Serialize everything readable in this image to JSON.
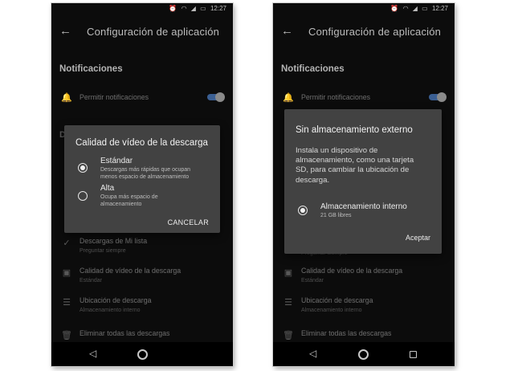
{
  "status_bar": {
    "time": "12:27"
  },
  "left": {
    "app_title": "Configuración de aplicación",
    "notifications_header": "Notificaciones",
    "permit_notifications": "Permitir notificaciones",
    "peek_section_letter": "D",
    "rows": [
      {
        "title": "Descargas de Mi lista",
        "subtitle": "Preguntar siempre",
        "icon": "check-icon"
      },
      {
        "title": "Calidad de vídeo de la descarga",
        "subtitle": "Estándar",
        "icon": "video-quality-icon"
      },
      {
        "title": "Ubicación de descarga",
        "subtitle": "Almacenamiento interno",
        "icon": "storage-icon"
      },
      {
        "title": "Eliminar todas las descargas",
        "subtitle": "",
        "icon": "trash-icon"
      }
    ],
    "dialog": {
      "title": "Calidad de vídeo de la descarga",
      "options": [
        {
          "label": "Estándar",
          "desc_line1": "Descargas más rápidas que ocupan",
          "desc_line2": "menos espacio de almacenamiento",
          "selected": true
        },
        {
          "label": "Alta",
          "desc_line1": "Ocupa más espacio de",
          "desc_line2": "almacenamiento",
          "selected": false
        }
      ],
      "cancel": "CANCELAR"
    }
  },
  "right": {
    "app_title": "Configuración de aplicación",
    "notifications_header": "Notificaciones",
    "permit_notifications": "Permitir notificaciones",
    "peek_subtitle": "Preguntar siempre",
    "rows": [
      {
        "title": "Calidad de vídeo de la descarga",
        "subtitle": "Estándar",
        "icon": "video-quality-icon"
      },
      {
        "title": "Ubicación de descarga",
        "subtitle": "Almacenamiento interno",
        "icon": "storage-icon"
      },
      {
        "title": "Eliminar todas las descargas",
        "subtitle": "",
        "icon": "trash-icon"
      }
    ],
    "dialog": {
      "title": "Sin almacenamiento externo",
      "body": "Instala un dispositivo de\nalmacenamiento, como una tarjeta\nSD, para cambiar la ubicación de\ndescarga.",
      "option_label": "Almacenamiento interno",
      "option_desc": "21 GB libres",
      "accept": "Aceptar"
    }
  },
  "colors": {
    "toggle_on": "#3b5f93",
    "dialog_bg": "#424242",
    "screen_bg": "#0c0c0c"
  }
}
